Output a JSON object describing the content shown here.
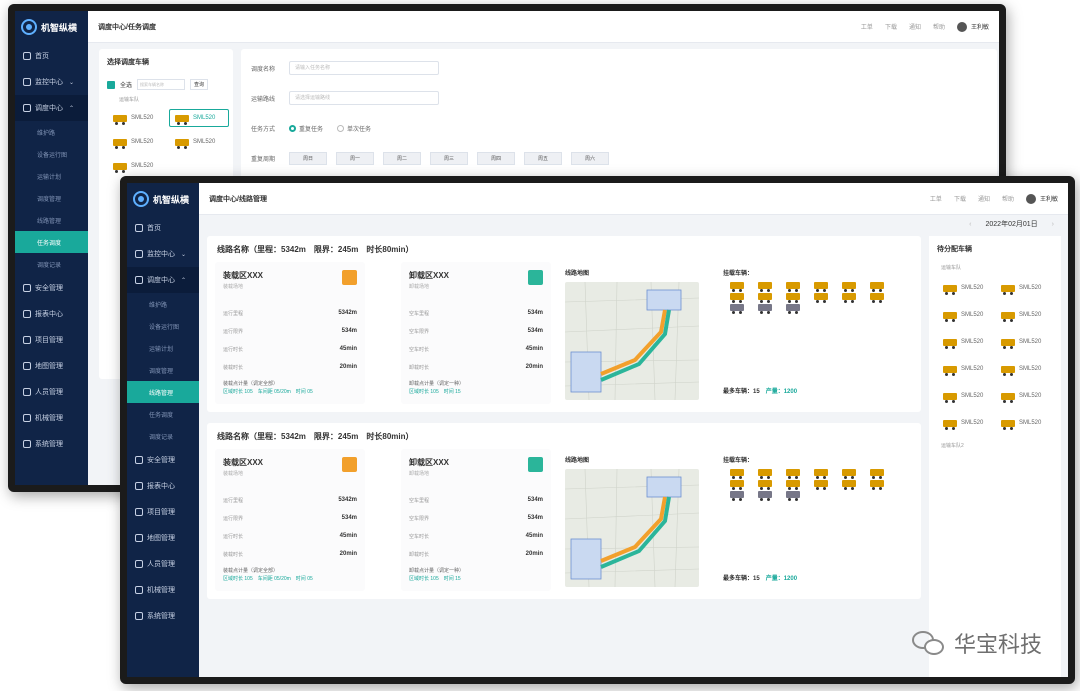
{
  "back": {
    "logo": "机智纵横",
    "breadcrumb": "调度中心/任务调度",
    "topbar": {
      "tool1": "工单",
      "tool2": "下载",
      "tool3": "通知",
      "tool4": "帮助",
      "user": "王利敏"
    },
    "menu": [
      {
        "label": "首页"
      },
      {
        "label": "监控中心"
      },
      {
        "label": "调度中心"
      }
    ],
    "submenu": [
      "维护路",
      "设备运行图",
      "运输计划",
      "调度管理",
      "线路管理",
      "任务调度",
      "调度记录"
    ],
    "menu2": [
      "安全管理",
      "报表中心",
      "项目管理",
      "地图管理",
      "人员管理",
      "机械管理",
      "系统管理"
    ],
    "select_panel": {
      "title": "选择调度车辆",
      "select_all": "全选",
      "search_placeholder": "搜索车辆名称",
      "search_btn": "查询",
      "group": "运输车队",
      "vehicles": [
        "SML520",
        "SML520",
        "SML520",
        "SML520",
        "SML520"
      ]
    },
    "form": {
      "name_label": "调度名称",
      "name_placeholder": "请输入任务名称",
      "route_label": "运输路线",
      "route_placeholder": "请选择运输路线",
      "mode_label": "任务方式",
      "mode_repeat": "重复任务",
      "mode_single": "单次任务",
      "cycle_label": "重复周期",
      "days": [
        "周日",
        "周一",
        "周二",
        "周三",
        "周四",
        "周五",
        "周六"
      ]
    }
  },
  "front": {
    "logo": "机智纵横",
    "breadcrumb": "调度中心/线路管理",
    "topbar": {
      "tool1": "工单",
      "tool2": "下载",
      "tool3": "通知",
      "tool4": "帮助",
      "user": "王利敏"
    },
    "date": "2022年02月01日",
    "menu": [
      {
        "label": "首页"
      },
      {
        "label": "监控中心"
      },
      {
        "label": "调度中心"
      }
    ],
    "submenu": [
      "维护路",
      "设备运行图",
      "运输计划",
      "调度管理",
      "线路管理",
      "任务调度",
      "调度记录"
    ],
    "menu2": [
      "安全管理",
      "报表中心",
      "项目管理",
      "地图管理",
      "人员管理",
      "机械管理",
      "系统管理"
    ],
    "routes": [
      {
        "title": "线路名称（里程：5342m　限界：245m　时长80min）",
        "load": {
          "name": "装载区XXX",
          "sub": "装载场地",
          "rows": [
            [
              "运行里程",
              "5342m"
            ],
            [
              "运行限界",
              "534m"
            ],
            [
              "运行时长",
              "45min"
            ],
            [
              "装载时长",
              "20min"
            ]
          ],
          "foot1": "装载点计量（调定全部）",
          "foot2": "区域时长 105　车间距 05/20m　时间 05"
        },
        "unload": {
          "name": "卸载区XXX",
          "sub": "卸载场地",
          "rows": [
            [
              "空车里程",
              "534m"
            ],
            [
              "空车限界",
              "534m"
            ],
            [
              "空车时长",
              "45min"
            ],
            [
              "卸载时长",
              "20min"
            ]
          ],
          "foot1": "卸载点计量（调定一种）",
          "foot2": "区域时长 105　时间 15"
        },
        "map_title": "线路地图",
        "trucks_title": "挂载车辆：",
        "truck_count": "最多车辆：15",
        "capacity": "产量：1200"
      },
      {
        "title": "线路名称（里程：5342m　限界：245m　时长80min）",
        "load": {
          "name": "装载区XXX",
          "sub": "装载场地",
          "rows": [
            [
              "运行里程",
              "5342m"
            ],
            [
              "运行限界",
              "534m"
            ],
            [
              "运行时长",
              "45min"
            ],
            [
              "装载时长",
              "20min"
            ]
          ],
          "foot1": "装载点计量（调定全部）",
          "foot2": "区域时长 105　车间距 05/20m　时间 05"
        },
        "unload": {
          "name": "卸载区XXX",
          "sub": "卸载场地",
          "rows": [
            [
              "空车里程",
              "534m"
            ],
            [
              "空车限界",
              "534m"
            ],
            [
              "空车时长",
              "45min"
            ],
            [
              "卸载时长",
              "20min"
            ]
          ],
          "foot1": "卸载点计量（调定一种）",
          "foot2": "区域时长 105　时间 15"
        },
        "map_title": "线路地图",
        "trucks_title": "挂载车辆：",
        "truck_count": "最多车辆：15",
        "capacity": "产量：1200"
      }
    ],
    "right": {
      "title": "待分配车辆",
      "group1": "运输车队",
      "vehicles": [
        "SML520",
        "SML520",
        "SML520",
        "SML520",
        "SML520",
        "SML520",
        "SML520",
        "SML520",
        "SML520",
        "SML520",
        "SML520",
        "SML520"
      ],
      "group2": "运输车队2"
    }
  },
  "watermark": "华宝科技",
  "colors": {
    "accent": "#19a99b",
    "sidebar": "#102447",
    "badge_load": "#f2a02c",
    "badge_unload": "#2bb59a"
  }
}
